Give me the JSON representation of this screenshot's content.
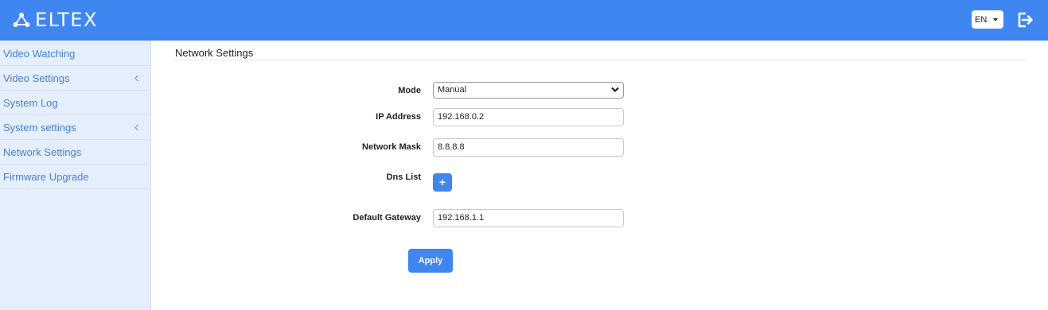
{
  "header": {
    "brand": "ELTEX",
    "language": "EN",
    "colors": {
      "bar": "#3f86f0",
      "accent": "#3f86f0"
    },
    "icons": [
      "eltex-logo-icon",
      "caret-down-icon",
      "logout-icon"
    ]
  },
  "sidebar": {
    "items": [
      {
        "label": "Video Watching",
        "has_chevron": false
      },
      {
        "label": "Video Settings",
        "has_chevron": true
      },
      {
        "label": "System Log",
        "has_chevron": false
      },
      {
        "label": "System settings",
        "has_chevron": true
      },
      {
        "label": "Network Settings",
        "has_chevron": false
      },
      {
        "label": "Firmware Upgrade",
        "has_chevron": false
      }
    ],
    "chevron_icon": "chevron-left-icon"
  },
  "main": {
    "title": "Network Settings",
    "form": {
      "mode_label": "Mode",
      "mode_value": "Manual",
      "ip_label": "IP Address",
      "ip_value": "192.168.0.2",
      "mask_label": "Network Mask",
      "mask_value": "8.8.8.8",
      "dns_label": "Dns List",
      "dns_add": "+",
      "gateway_label": "Default Gateway",
      "gateway_value": "192.168.1.1",
      "apply": "Apply"
    }
  }
}
